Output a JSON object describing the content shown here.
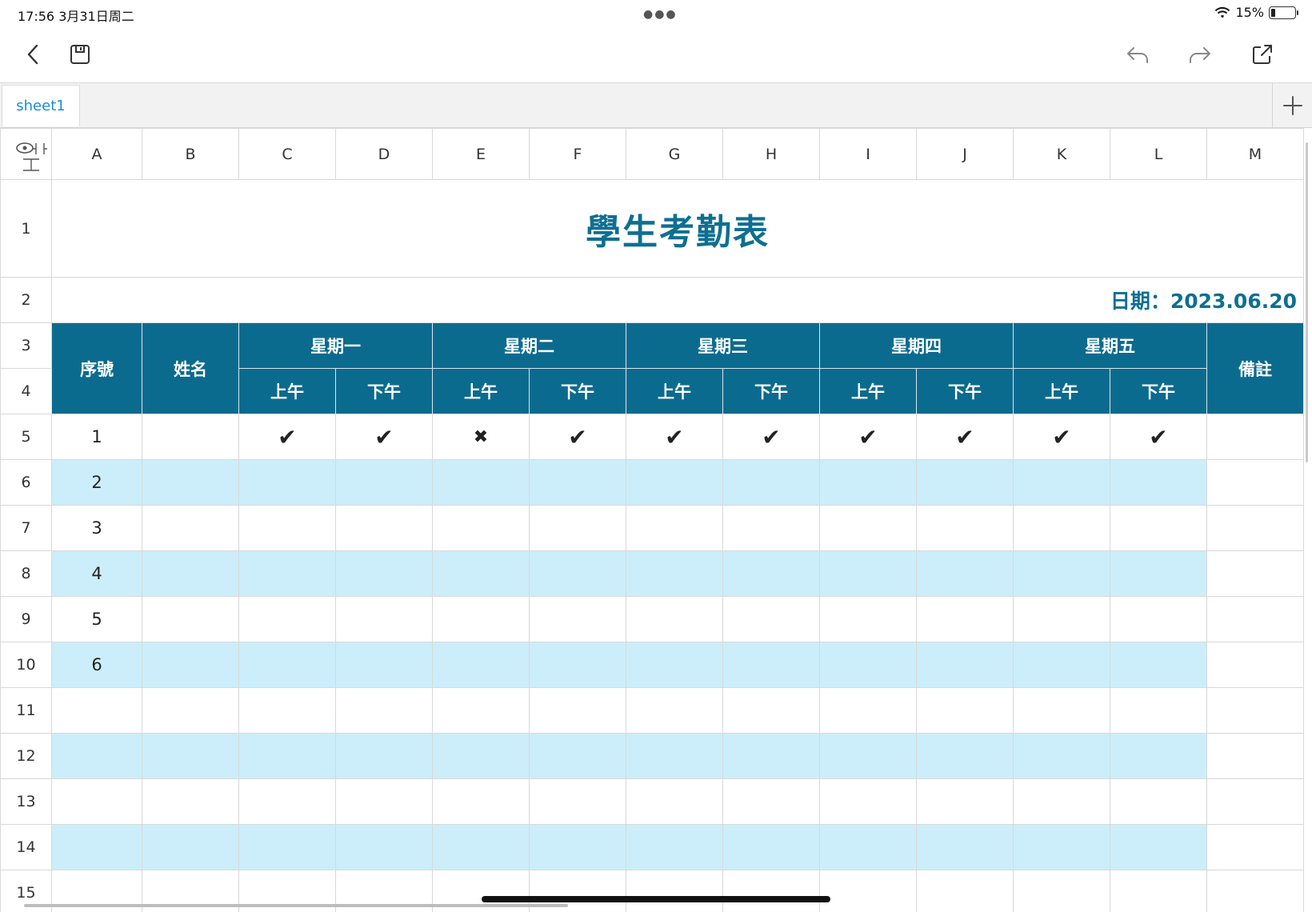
{
  "status_bar": {
    "time": "17:56  3月31日周二",
    "battery": "15%",
    "wifi_icon": "wifi-icon",
    "battery_level": 0.15
  },
  "toolbar": {
    "back_icon": "chevron-left-icon",
    "save_icon": "floppy-disk-icon",
    "undo_icon": "undo-icon",
    "redo_icon": "redo-icon",
    "share_icon": "share-icon"
  },
  "sheet_tabs": {
    "active": "sheet1",
    "add_icon": "plus-icon"
  },
  "grid": {
    "columns": [
      "A",
      "B",
      "C",
      "D",
      "E",
      "F",
      "G",
      "H",
      "I",
      "J",
      "K",
      "L",
      "M"
    ],
    "rows": [
      "1",
      "2",
      "3",
      "4",
      "5",
      "6",
      "7",
      "8",
      "9",
      "10",
      "11",
      "12",
      "13",
      "14",
      "15"
    ],
    "title": "學生考勤表",
    "date": "日期：2023.06.20",
    "headers": {
      "seq": "序號",
      "name": "姓名",
      "remark": "備註",
      "days": [
        "星期一",
        "星期二",
        "星期三",
        "星期四",
        "星期五"
      ],
      "am": "上午",
      "pm": "下午"
    },
    "numbers": [
      "1",
      "2",
      "3",
      "4",
      "5",
      "6"
    ],
    "row5_marks": [
      "✔",
      "✔",
      "✖",
      "✔",
      "✔",
      "✔",
      "✔",
      "✔",
      "✔",
      "✔"
    ],
    "colors": {
      "header_bg": "#0b6b8e",
      "title": "#0e6f91",
      "stripe": "#cbeefa"
    }
  }
}
